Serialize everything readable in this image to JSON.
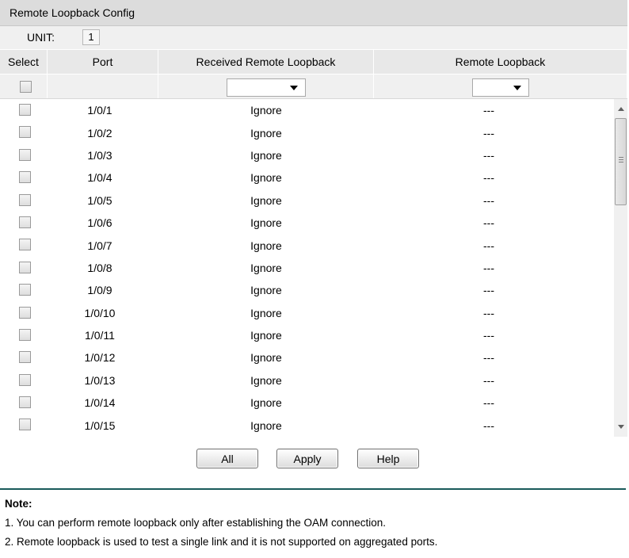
{
  "panel": {
    "title": "Remote Loopback Config"
  },
  "unit": {
    "label": "UNIT:",
    "value": "1"
  },
  "columns": [
    "Select",
    "Port",
    "Received Remote Loopback",
    "Remote Loopback"
  ],
  "filter": {
    "received_remote_loopback": "",
    "remote_loopback": ""
  },
  "rows": [
    {
      "port": "1/0/1",
      "received": "Ignore",
      "remote": "---"
    },
    {
      "port": "1/0/2",
      "received": "Ignore",
      "remote": "---"
    },
    {
      "port": "1/0/3",
      "received": "Ignore",
      "remote": "---"
    },
    {
      "port": "1/0/4",
      "received": "Ignore",
      "remote": "---"
    },
    {
      "port": "1/0/5",
      "received": "Ignore",
      "remote": "---"
    },
    {
      "port": "1/0/6",
      "received": "Ignore",
      "remote": "---"
    },
    {
      "port": "1/0/7",
      "received": "Ignore",
      "remote": "---"
    },
    {
      "port": "1/0/8",
      "received": "Ignore",
      "remote": "---"
    },
    {
      "port": "1/0/9",
      "received": "Ignore",
      "remote": "---"
    },
    {
      "port": "1/0/10",
      "received": "Ignore",
      "remote": "---"
    },
    {
      "port": "1/0/11",
      "received": "Ignore",
      "remote": "---"
    },
    {
      "port": "1/0/12",
      "received": "Ignore",
      "remote": "---"
    },
    {
      "port": "1/0/13",
      "received": "Ignore",
      "remote": "---"
    },
    {
      "port": "1/0/14",
      "received": "Ignore",
      "remote": "---"
    },
    {
      "port": "1/0/15",
      "received": "Ignore",
      "remote": "---"
    }
  ],
  "buttons": {
    "all": "All",
    "apply": "Apply",
    "help": "Help"
  },
  "note": {
    "title": "Note:",
    "lines": [
      "1. You can perform remote loopback only after establishing the OAM connection.",
      "2. Remote loopback is used to test a single link and it is not supported on aggregated ports."
    ]
  },
  "colors": {
    "title_bar": "#dcdcdc",
    "divider": "#1a5a5a"
  }
}
